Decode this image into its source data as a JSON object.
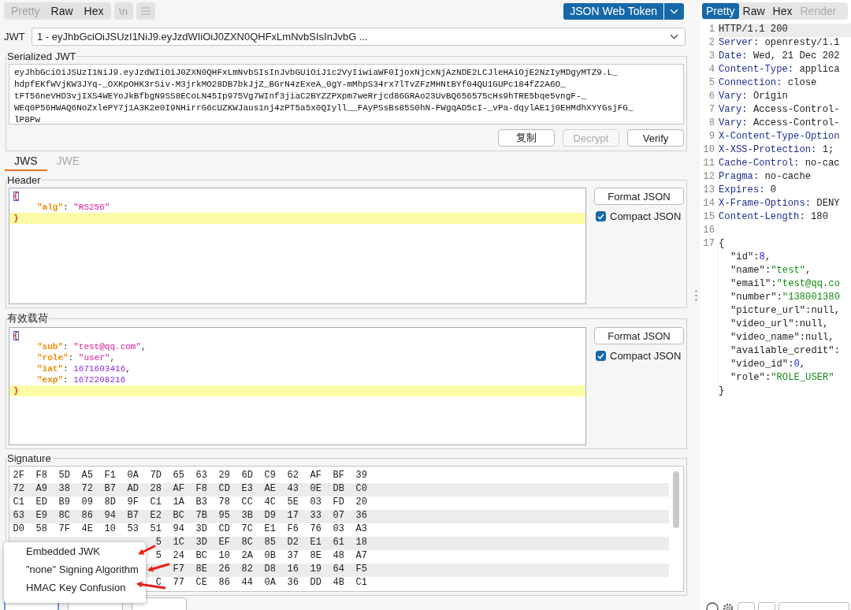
{
  "editor_toolbar": {
    "tabs": [
      {
        "label": "Pretty",
        "selected": false,
        "disabled": true
      },
      {
        "label": "Raw",
        "selected": false,
        "disabled": false
      },
      {
        "label": "Hex",
        "selected": false,
        "disabled": false
      }
    ],
    "newline_button": "\\n",
    "extension_button": "JSON Web Token"
  },
  "jwt_select": {
    "label": "JWT",
    "value": "1 - eyJhbGciOiJSUzI1NiJ9.eyJzdWIiOiJ0ZXN0QHFxLmNvbSIsInJvbG ..."
  },
  "serialized": {
    "label": "Serialized JWT",
    "lines": [
      "eyJhbGciOiJSUzI1NiJ9.eyJzdWIiOiJ0ZXN0QHFxLmNvbSIsInJvbGUiOiJ1c2VyIiwiaWF0IjoxNjcxNjAzNDE2LCJleHAiOjE2NzIyMDgyMTZ9.L_",
      "hdpfEKfWVjKW3JYq-_OXKpOHK3rSiv-M3jrkMO28DB7bkJjZ_BGrN4zExeA_0gY-mMhpS34rx7lTvZFzMHNtBYf04QU1GUPc184fZ2A6O_",
      "tFT56neVHD3vjIXS4WEYoJkBfbgN9SS8ECoLN45Ip975Vg7WInf3jiaC2BYZZPXpm7weRrjcd86GRAo23UvBQ656575cHs9hTRE5bqe5vngF-_",
      "WEq0P56HWAQ6NoZxlePY7j1A3K2e0I9NHirrG6cUZKWJaus1nj4zPT5a5x0QIyll__FAyPSsBs85S0hN-FWgqAD5cI-_vPa-dqylAE1j0EHMdhXYYGsjFG_",
      "lP8Pw"
    ],
    "buttons": [
      {
        "label": "复制",
        "disabled": false
      },
      {
        "label": "Decrypt",
        "disabled": true
      },
      {
        "label": "Verify",
        "disabled": false
      }
    ]
  },
  "token_tabs": [
    {
      "label": "JWS",
      "selected": true
    },
    {
      "label": "JWE",
      "selected": false
    }
  ],
  "sections": [
    {
      "label": "Header",
      "format_button": "Format JSON",
      "compact": {
        "label": "Compact JSON",
        "checked": true
      },
      "lines": [
        {
          "indented": false,
          "highlighted": false,
          "segments": [
            {
              "kind": "brace_match",
              "text": "{"
            }
          ]
        },
        {
          "indented": true,
          "highlighted": false,
          "segments": [
            {
              "kind": "key",
              "text": "\"alg\""
            },
            {
              "kind": "punct",
              "text": ": "
            },
            {
              "kind": "string",
              "text": "\"RS256\""
            }
          ]
        },
        {
          "indented": false,
          "highlighted": true,
          "segments": [
            {
              "kind": "brace",
              "text": "}"
            }
          ]
        }
      ]
    },
    {
      "label": "有效载荷",
      "format_button": "Format JSON",
      "compact": {
        "label": "Compact JSON",
        "checked": true
      },
      "lines": [
        {
          "indented": false,
          "highlighted": false,
          "segments": [
            {
              "kind": "brace_match",
              "text": "{"
            }
          ]
        },
        {
          "indented": true,
          "highlighted": false,
          "segments": [
            {
              "kind": "key",
              "text": "\"sub\""
            },
            {
              "kind": "punct",
              "text": ": "
            },
            {
              "kind": "string",
              "text": "\"test@qq.com\""
            },
            {
              "kind": "punct",
              "text": ","
            }
          ]
        },
        {
          "indented": true,
          "highlighted": false,
          "segments": [
            {
              "kind": "key",
              "text": "\"role\""
            },
            {
              "kind": "punct",
              "text": ": "
            },
            {
              "kind": "string",
              "text": "\"user\""
            },
            {
              "kind": "punct",
              "text": ","
            }
          ]
        },
        {
          "indented": true,
          "highlighted": false,
          "segments": [
            {
              "kind": "key",
              "text": "\"iat\""
            },
            {
              "kind": "punct",
              "text": ": "
            },
            {
              "kind": "number",
              "text": "1671603416"
            },
            {
              "kind": "punct",
              "text": ","
            }
          ]
        },
        {
          "indented": true,
          "highlighted": false,
          "segments": [
            {
              "kind": "key",
              "text": "\"exp\""
            },
            {
              "kind": "punct",
              "text": ": "
            },
            {
              "kind": "number",
              "text": "1672208216"
            }
          ]
        },
        {
          "indented": false,
          "highlighted": true,
          "segments": [
            {
              "kind": "brace",
              "text": "}"
            }
          ]
        }
      ]
    }
  ],
  "signature": {
    "label": "Signature",
    "rows": [
      "2F F8 5D A5 F1 0A 7D 65 63 29 6D C9 62 AF BF 39",
      "72 A9 38 72 B7 AD 28 AF F8 CD E3 AE 43 0E DB C0",
      "C1 ED B9 09 8D 9F C1 1A B3 78 CC 4C 5E 03 FD 20",
      "63 E9 8C 86 94 B7 E2 BC 7B 95 3B D9 17 33 07 36",
      "D0 58 7F 4E 10 53 51 94 3D CD 7C E1 F6 76 03 A3",
      "5 1C 3D EF 8C 85 D2 E1 61 18",
      "5 24 BC 10 2A 0B 37 8E 48 A7",
      "F7 8E 26 82 D8 16 19 64 F5",
      "C 77 CE 86 44 0A 36 DD 4B C1"
    ]
  },
  "attack_menu": [
    "Embedded JWK",
    "\"none\" Signing Algorithm",
    "HMAC Key Confusion"
  ],
  "response": {
    "tabs": [
      {
        "label": "Pretty",
        "selected": true,
        "disabled": false
      },
      {
        "label": "Raw",
        "selected": false,
        "disabled": false
      },
      {
        "label": "Hex",
        "selected": false,
        "disabled": false
      },
      {
        "label": "Render",
        "selected": false,
        "disabled": true
      }
    ],
    "lines": [
      {
        "number": "1",
        "current": true,
        "indented": false,
        "segments": [
          {
            "kind": "plain",
            "text": "HTTP/1.1 200"
          }
        ]
      },
      {
        "number": "2",
        "current": false,
        "indented": false,
        "segments": [
          {
            "kind": "name",
            "text": "Server:"
          },
          {
            "kind": "plain",
            "text": " openresty/1.1"
          }
        ]
      },
      {
        "number": "3",
        "current": false,
        "indented": false,
        "segments": [
          {
            "kind": "name",
            "text": "Date:"
          },
          {
            "kind": "plain",
            "text": " Wed, 21 Dec 202"
          }
        ]
      },
      {
        "number": "4",
        "current": false,
        "indented": false,
        "segments": [
          {
            "kind": "name",
            "text": "Content-Type:"
          },
          {
            "kind": "plain",
            "text": " applica"
          }
        ]
      },
      {
        "number": "5",
        "current": false,
        "indented": false,
        "segments": [
          {
            "kind": "name",
            "text": "Connection:"
          },
          {
            "kind": "plain",
            "text": " close"
          }
        ]
      },
      {
        "number": "6",
        "current": false,
        "indented": false,
        "segments": [
          {
            "kind": "name",
            "text": "Vary:"
          },
          {
            "kind": "plain",
            "text": " Origin"
          }
        ]
      },
      {
        "number": "7",
        "current": false,
        "indented": false,
        "segments": [
          {
            "kind": "name",
            "text": "Vary:"
          },
          {
            "kind": "plain",
            "text": " Access-Control-"
          }
        ]
      },
      {
        "number": "8",
        "current": false,
        "indented": false,
        "segments": [
          {
            "kind": "name",
            "text": "Vary:"
          },
          {
            "kind": "plain",
            "text": " Access-Control-"
          }
        ]
      },
      {
        "number": "9",
        "current": false,
        "indented": false,
        "segments": [
          {
            "kind": "name",
            "text": "X-Content-Type-Option"
          }
        ]
      },
      {
        "number": "10",
        "current": false,
        "indented": false,
        "segments": [
          {
            "kind": "name",
            "text": "X-XSS-Protection:"
          },
          {
            "kind": "plain",
            "text": " 1;"
          }
        ]
      },
      {
        "number": "11",
        "current": false,
        "indented": false,
        "segments": [
          {
            "kind": "name",
            "text": "Cache-Control:"
          },
          {
            "kind": "plain",
            "text": " no-cac"
          }
        ]
      },
      {
        "number": "12",
        "current": false,
        "indented": false,
        "segments": [
          {
            "kind": "name",
            "text": "Pragma:"
          },
          {
            "kind": "plain",
            "text": " no-cache"
          }
        ]
      },
      {
        "number": "13",
        "current": false,
        "indented": false,
        "segments": [
          {
            "kind": "name",
            "text": "Expires:"
          },
          {
            "kind": "plain",
            "text": " 0"
          }
        ]
      },
      {
        "number": "14",
        "current": false,
        "indented": false,
        "segments": [
          {
            "kind": "name",
            "text": "X-Frame-Options:"
          },
          {
            "kind": "plain",
            "text": " DENY"
          }
        ]
      },
      {
        "number": "15",
        "current": false,
        "indented": false,
        "segments": [
          {
            "kind": "name",
            "text": "Content-Length:"
          },
          {
            "kind": "plain",
            "text": " 180"
          }
        ]
      },
      {
        "number": "16",
        "current": false
      },
      {
        "number": "17",
        "current": false,
        "indented": false,
        "segments": [
          {
            "kind": "plain",
            "text": "{"
          }
        ]
      },
      {
        "current": false,
        "indented": true,
        "segments": [
          {
            "kind": "key",
            "text": "\"id\""
          },
          {
            "kind": "plain",
            "text": ":"
          },
          {
            "kind": "number",
            "text": "8"
          },
          {
            "kind": "plain",
            "text": ","
          }
        ]
      },
      {
        "current": false,
        "indented": true,
        "segments": [
          {
            "kind": "key",
            "text": "\"name\""
          },
          {
            "kind": "plain",
            "text": ":"
          },
          {
            "kind": "string",
            "text": "\"test\""
          },
          {
            "kind": "plain",
            "text": ","
          }
        ]
      },
      {
        "current": false,
        "indented": true,
        "segments": [
          {
            "kind": "key",
            "text": "\"email\""
          },
          {
            "kind": "plain",
            "text": ":"
          },
          {
            "kind": "string",
            "text": "\"test@qq.co"
          }
        ]
      },
      {
        "current": false,
        "indented": true,
        "segments": [
          {
            "kind": "key",
            "text": "\"number\""
          },
          {
            "kind": "plain",
            "text": ":"
          },
          {
            "kind": "string",
            "text": "\"138001380"
          }
        ]
      },
      {
        "current": false,
        "indented": true,
        "segments": [
          {
            "kind": "key",
            "text": "\"picture_url\""
          },
          {
            "kind": "plain",
            "text": ":null,"
          }
        ]
      },
      {
        "current": false,
        "indented": true,
        "segments": [
          {
            "kind": "key",
            "text": "\"video_url\""
          },
          {
            "kind": "plain",
            "text": ":null,"
          }
        ]
      },
      {
        "current": false,
        "indented": true,
        "segments": [
          {
            "kind": "key",
            "text": "\"video_name\""
          },
          {
            "kind": "plain",
            "text": ":null,"
          }
        ]
      },
      {
        "current": false,
        "indented": true,
        "segments": [
          {
            "kind": "key",
            "text": "\"available_credit\""
          },
          {
            "kind": "plain",
            "text": ":"
          }
        ]
      },
      {
        "current": false,
        "indented": true,
        "segments": [
          {
            "kind": "key",
            "text": "\"video_id\""
          },
          {
            "kind": "plain",
            "text": ":"
          },
          {
            "kind": "number",
            "text": "0"
          },
          {
            "kind": "plain",
            "text": ","
          }
        ]
      },
      {
        "current": false,
        "indented": true,
        "segments": [
          {
            "kind": "key",
            "text": "\"role\""
          },
          {
            "kind": "plain",
            "text": ":"
          },
          {
            "kind": "string",
            "text": "\"ROLE_USER\""
          }
        ]
      },
      {
        "current": false,
        "indented": false,
        "segments": [
          {
            "kind": "plain",
            "text": "}"
          }
        ]
      }
    ]
  }
}
